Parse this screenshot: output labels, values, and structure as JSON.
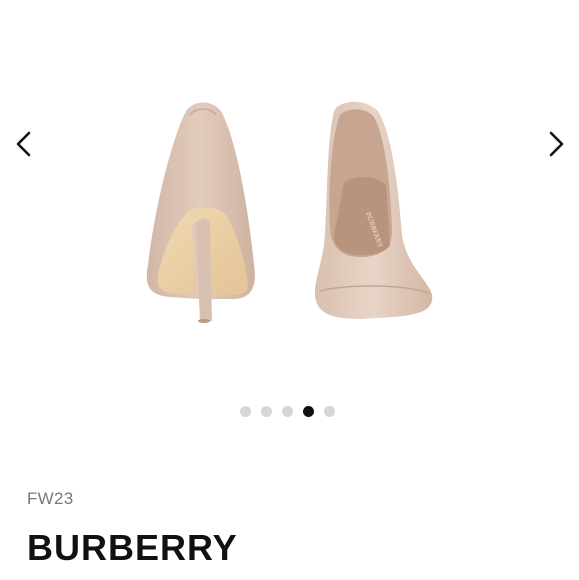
{
  "gallery": {
    "image_alt": "Burberry nude pointed-toe pumps, back and front view",
    "prev_icon": "chevron-left-icon",
    "next_icon": "chevron-right-icon",
    "total_images": 5,
    "current_index": 4
  },
  "product": {
    "season": "FW23",
    "brand": "BURBERRY"
  },
  "colors": {
    "dot_inactive": "#d6d6d6",
    "dot_active": "#111111",
    "season_text": "#7a7a7a",
    "brand_text": "#111111"
  }
}
